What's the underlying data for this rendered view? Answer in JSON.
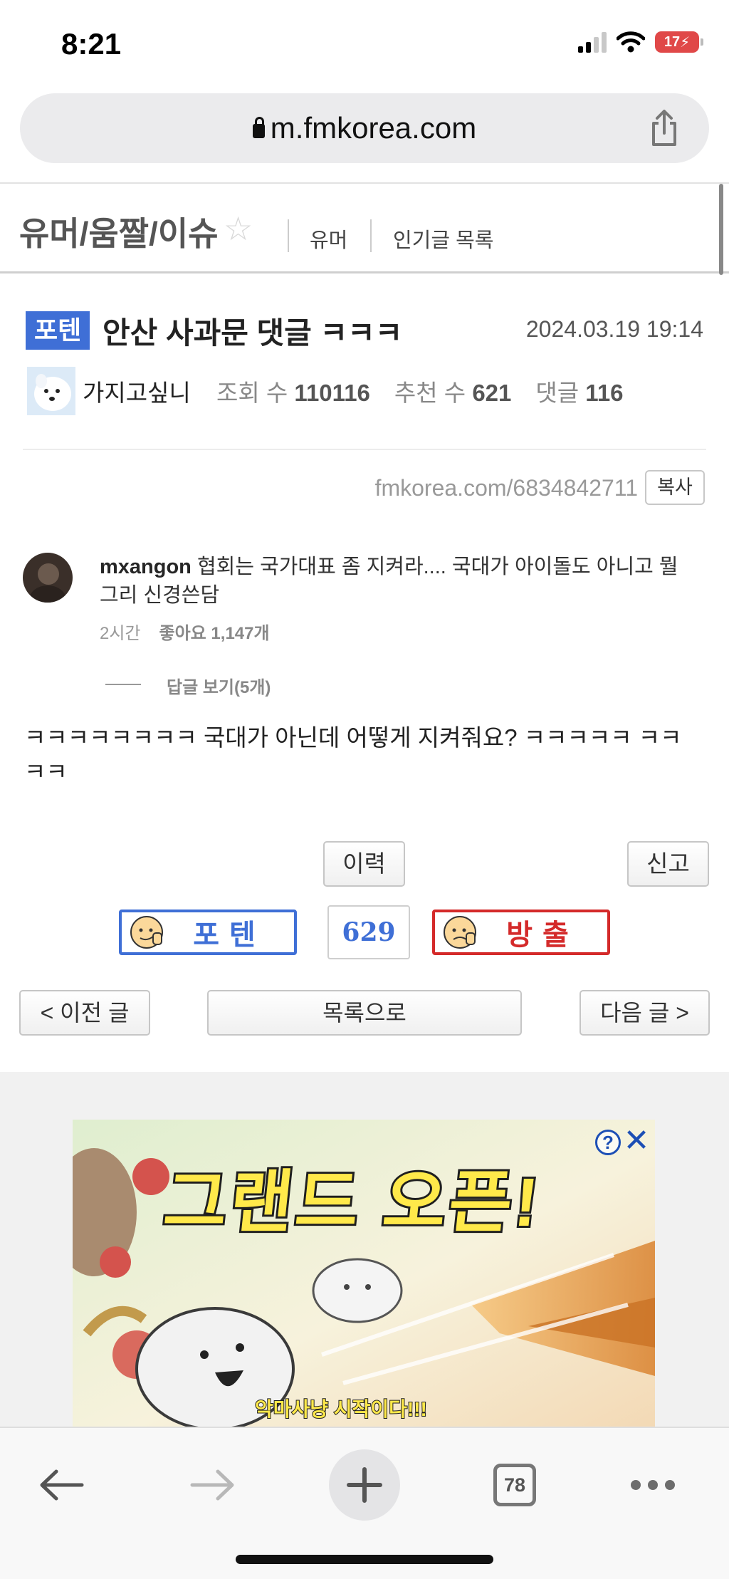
{
  "status_bar": {
    "time": "8:21",
    "battery": "17"
  },
  "browser": {
    "url": "m.fmkorea.com",
    "tab_count": "78"
  },
  "board": {
    "title": "유머/움짤/이슈",
    "links": [
      "유머",
      "인기글 목록"
    ]
  },
  "post": {
    "badge": "포텐",
    "title": "안산 사과문 댓글 ㅋㅋㅋ",
    "date": "2024.03.19 19:14",
    "author": "가지고싶니",
    "views_label": "조회 수",
    "views": "110116",
    "recommend_label": "추천 수",
    "recommend": "621",
    "comments_label": "댓글",
    "comments": "116",
    "short_url": "fmkorea.com/6834842711",
    "copy_label": "복사",
    "body": "ㅋㅋㅋㅋㅋㅋㅋㅋ 국대가 아닌데 어떻게 지켜줘요? ㅋㅋㅋㅋㅋ ㅋㅋㅋㅋ"
  },
  "embedded_comment": {
    "username": "mxangon",
    "text": "협회는 국가대표 좀 지켜라.... 국대가 아이돌도 아니고 뭘 그리 신경쓴담",
    "time": "2시간",
    "likes": "좋아요 1,147개",
    "view_replies": "답글 보기(5개)"
  },
  "actions": {
    "history": "이력",
    "report": "신고",
    "upvote": "포텐",
    "vote_count": "629",
    "downvote": "방출",
    "prev": "< 이전 글",
    "list": "목록으로",
    "next": "다음 글 >"
  },
  "ad": {
    "title": "그랜드 오픈!",
    "subtitle": "악마사냥 시작이다!!!",
    "help": "?",
    "close": "✕"
  },
  "colors": {
    "accent_blue": "#3f6fd6",
    "downvote_red": "#d42a2a",
    "battery_red": "#e04848"
  },
  "icons": [
    "lock-icon",
    "share-icon",
    "star-icon",
    "back-arrow-icon",
    "forward-arrow-icon",
    "plus-icon",
    "more-icon"
  ]
}
